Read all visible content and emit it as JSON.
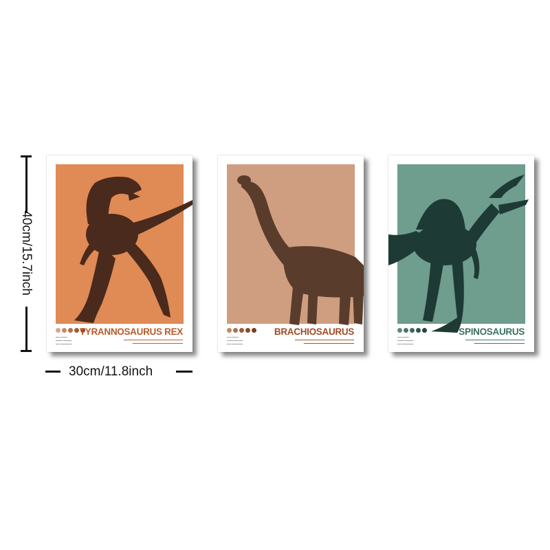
{
  "dimensions": {
    "height_label": "40cm/15.7inch",
    "width_label": "30cm/11.8inch"
  },
  "posters": [
    {
      "title": "TYRANNOSAURUS REX",
      "panel_color": "#e08a55",
      "accent_color": "#b85a2a",
      "dino_color": "#4a2a1c",
      "dot_colors": [
        "#d4a68a",
        "#c98a66",
        "#b86c44",
        "#a85a34",
        "#8a4626"
      ]
    },
    {
      "title": "BRACHIOSAURUS",
      "panel_color": "#cf9e80",
      "accent_color": "#a24a22",
      "dino_color": "#5a3c2c",
      "dot_colors": [
        "#c48660",
        "#b07050",
        "#9c5a3c",
        "#8a4a2e",
        "#7a3e24"
      ]
    },
    {
      "title": "SPINOSAURUS",
      "panel_color": "#6f9d8e",
      "accent_color": "#3c6f62",
      "dino_color": "#1e3a34",
      "dot_colors": [
        "#5e8a7e",
        "#4c786c",
        "#3e685c",
        "#2f574c",
        "#24463e"
      ]
    }
  ]
}
